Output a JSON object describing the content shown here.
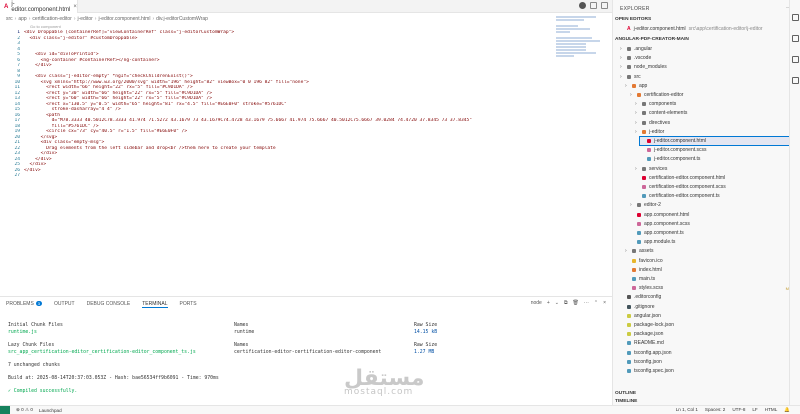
{
  "editor_tab": {
    "icon": "A",
    "title": "j-editor.component.html",
    "close": "×"
  },
  "breadcrumb": [
    "src",
    "app",
    "certification-editor",
    "j-editor",
    "j-editor.component.html",
    "div.j-editorCustomWrap"
  ],
  "codelens_hint": "Go to component",
  "code_lines": [
    "<div Droppable [containerRef]=\"viewContainerRef\" class=\"j-editorCustomWrap\">",
    "  <div class=\"j-editor\" #customDroppable>",
    "",
    "",
    "    <div id=\"divToPrintId\">",
    "      <ng-container #containerRef></ng-container>",
    "    </div>",
    "",
    "    <div class=\"j-editor-empty\" *ngIf=\"checkChildrenExist()\">",
    "      <svg xmlns=\"http://www.w3.org/2000/svg\" width=\"196\" height=\"82\" viewBox=\"0 0 196 82\" fill=\"none\">",
    "        <rect width=\"66\" height=\"22\" rx=\"5\" fill=\"#C9D1DA\" />",
    "        <rect y=\"30\" width=\"66\" height=\"22\" rx=\"5\" fill=\"#C9D1DA\" />",
    "        <rect y=\"60\" width=\"66\" height=\"22\" rx=\"5\" fill=\"#C9D1DA\" />",
    "        <rect x=\"130.5\" y=\"0.5\" width=\"65\" height=\"81\" rx=\"4.5\" fill=\"#E6E0F0\" stroke=\"#5761DC\"",
    "          stroke-dasharray=\"4 4\" />",
    "        <path",
    "          d=\"M78.3333 40.5012C78.3333 41.974 71.5272 43.1679 73 43.1679C74.4728 43.1679 75.6667 41.974 75.6667 40.5012C75.6667 39.0284 74.4720 37.8345 73 37.8345\"",
    "          fill=\"#5761DC\" />",
    "        <circle cx=\"73\" cy=\"40.5\" r=\"1.5\" fill=\"#E6E0F0\" />",
    "      </svg>",
    "      <div class=\"empty-msg\">",
    "        Drag elements from the left sidebar and drop<br />them here to create your template",
    "      </div>",
    "    </div>",
    "  </div>",
    "</div>",
    ""
  ],
  "explorer": {
    "title": "EXPLORER",
    "more": "···",
    "open_editors_label": "OPEN EDITORS",
    "open_editor": {
      "icon": "A",
      "name": "j-editor.component.html",
      "path": "src\\app\\certification-editor\\j-editor"
    },
    "project_label": "ANGULAR-PDF-CREATOR-MAIN",
    "outline_label": "OUTLINE",
    "timeline_label": "TIMELINE",
    "tree": [
      {
        "label": ".angular",
        "color": "#777777"
      },
      {
        "label": ".vscode",
        "color": "#777777"
      },
      {
        "label": "node_modules",
        "color": "#777777"
      },
      {
        "label": "src",
        "color": "#777777"
      },
      {
        "label": "app",
        "color": "#e37933"
      },
      {
        "label": "certification-editor",
        "color": "#e37933",
        "mod": "●"
      },
      {
        "label": "components",
        "color": "#777777"
      },
      {
        "label": "content-elements",
        "color": "#777777"
      },
      {
        "label": "directives",
        "color": "#777777"
      },
      {
        "label": "j-editor",
        "color": "#e37933"
      },
      {
        "label": "j-editor.component.html",
        "color": "#dd0031"
      },
      {
        "label": "j-editor.component.scss",
        "color": "#cd6799"
      },
      {
        "label": "j-editor.component.ts",
        "color": "#519aba",
        "mod": "M"
      },
      {
        "label": "services",
        "color": "#777777"
      },
      {
        "label": "certification-editor.component.html",
        "color": "#dd0031"
      },
      {
        "label": "certification-editor.component.scss",
        "color": "#cd6799"
      },
      {
        "label": "certification-editor.component.ts",
        "color": "#519aba"
      },
      {
        "label": "editor-2",
        "color": "#777777"
      },
      {
        "label": "app.component.html",
        "color": "#dd0031"
      },
      {
        "label": "app.component.scss",
        "color": "#cd6799"
      },
      {
        "label": "app.component.ts",
        "color": "#519aba"
      },
      {
        "label": "app.module.ts",
        "color": "#519aba"
      },
      {
        "label": "assets",
        "color": "#777777"
      },
      {
        "label": "favicon.ico",
        "color": "#e8b62c"
      },
      {
        "label": "index.html",
        "color": "#e37933"
      },
      {
        "label": "main.ts",
        "color": "#519aba"
      },
      {
        "label": "styles.scss",
        "color": "#cd6799",
        "mod": "M"
      },
      {
        "label": ".editorconfig",
        "color": "#555555"
      },
      {
        "label": ".gitignore",
        "color": "#41535b"
      },
      {
        "label": "angular.json",
        "color": "#cbcb41"
      },
      {
        "label": "package-lock.json",
        "color": "#cbcb41"
      },
      {
        "label": "package.json",
        "color": "#cbcb41"
      },
      {
        "label": "README.md",
        "color": "#519aba"
      },
      {
        "label": "tsconfig.app.json",
        "color": "#519aba"
      },
      {
        "label": "tsconfig.json",
        "color": "#519aba"
      },
      {
        "label": "tsconfig.spec.json",
        "color": "#519aba"
      }
    ]
  },
  "panel": {
    "tabs": [
      "PROBLEMS",
      "OUTPUT",
      "DEBUG CONSOLE",
      "TERMINAL",
      "PORTS"
    ],
    "problems_count": "3",
    "active_tab": "TERMINAL",
    "terminal_kind": "node",
    "tools": [
      "+",
      "⌄",
      "⧉",
      "🗑",
      "···",
      "⌃",
      "×"
    ],
    "terminal": {
      "initial_header": "Initial Chunk Files",
      "initial_file": "runtime.js",
      "initial_names_header": "Names",
      "initial_name": "runtime",
      "raw_size_header": "Raw Size",
      "initial_size": "14.15 kB",
      "lazy_header": "Lazy Chunk Files",
      "lazy_file": "src_app_certification-editor_certification-editor_component_ts.js",
      "lazy_names_header": "Names",
      "lazy_name": "certification-editor-certification-editor-component",
      "lazy_raw_header": "Raw Size",
      "lazy_size": "1.27 MB",
      "unchanged": "7 unchanged chunks",
      "build_line": "Build at: 2025-08-14T20:37:03.053Z - Hash: bae56534ff9b6091 - Time: 970ms",
      "compiled": "✓ Compiled successfully."
    }
  },
  "watermark": {
    "arabic": "مستقل",
    "latin": "mostaql.com"
  },
  "status": {
    "launchpad": "Launchpad",
    "errors": "⊗ 0 ⚠ 0",
    "cursor": "Ln 1, Col 1",
    "spaces": "Spaces: 2",
    "encoding": "UTF-8",
    "eol": "LF",
    "language": "HTML",
    "bell": "🔔"
  }
}
